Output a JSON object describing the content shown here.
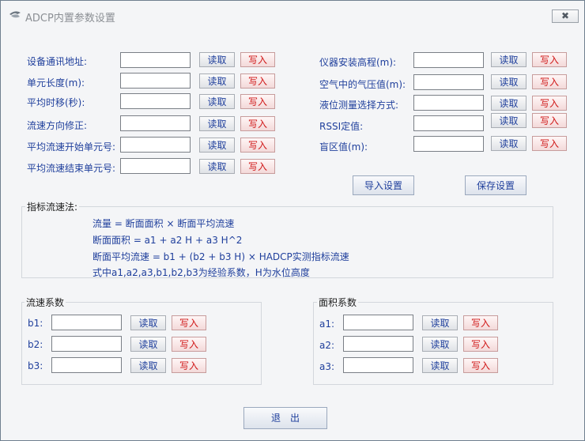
{
  "window": {
    "title": "ADCP内置参数设置",
    "close_glyph": "✖"
  },
  "left_params": [
    {
      "label": "设备通讯地址:",
      "value": "",
      "read": "读取",
      "write": "写入"
    },
    {
      "label": "单元长度(m):",
      "value": "",
      "read": "读取",
      "write": "写入"
    },
    {
      "label": "平均时移(秒):",
      "value": "",
      "read": "读取",
      "write": "写入"
    },
    {
      "label": "流速方向修正:",
      "value": "",
      "read": "读取",
      "write": "写入"
    },
    {
      "label": "平均流速开始单元号:",
      "value": "",
      "read": "读取",
      "write": "写入"
    },
    {
      "label": "平均流速结束单元号:",
      "value": "",
      "read": "读取",
      "write": "写入"
    }
  ],
  "right_params": [
    {
      "label": "仪器安装高程(m):",
      "value": "",
      "read": "读取",
      "write": "写入"
    },
    {
      "label": "空气中的气压值(m):",
      "value": "",
      "read": "读取",
      "write": "写入"
    },
    {
      "label": "液位测量选择方式:",
      "value": "",
      "read": "读取",
      "write": "写入"
    },
    {
      "label": "RSSI定值:",
      "value": "",
      "read": "读取",
      "write": "写入"
    },
    {
      "label": "盲区值(m):",
      "value": "",
      "read": "读取",
      "write": "写入"
    }
  ],
  "actions": {
    "import_label": "导入设置",
    "save_label": "保存设置",
    "exit_label": "退　出"
  },
  "method": {
    "title": "指标流速法:",
    "lines": [
      "流量 = 断面面积 × 断面平均流速",
      "断面面积 =  a1 + a2 H + a3 H^2",
      "断面平均流速 =  b1 + (b2 + b3 H) × HADCP实测指标流速",
      "式中a1,a2,a3,b1,b2,b3为经验系数，H为水位高度"
    ]
  },
  "velocity_coeff": {
    "title": "流速系数",
    "rows": [
      {
        "label": "b1:",
        "value": "",
        "read": "读取",
        "write": "写入"
      },
      {
        "label": "b2:",
        "value": "",
        "read": "读取",
        "write": "写入"
      },
      {
        "label": "b3:",
        "value": "",
        "read": "读取",
        "write": "写入"
      }
    ]
  },
  "area_coeff": {
    "title": "面积系数",
    "rows": [
      {
        "label": "a1:",
        "value": "",
        "read": "读取",
        "write": "写入"
      },
      {
        "label": "a2:",
        "value": "",
        "read": "读取",
        "write": "写入"
      },
      {
        "label": "a3:",
        "value": "",
        "read": "读取",
        "write": "写入"
      }
    ]
  },
  "colors": {
    "label_blue": "#1f3f9c",
    "write_red": "#d01818",
    "background": "#f4f5f7"
  }
}
